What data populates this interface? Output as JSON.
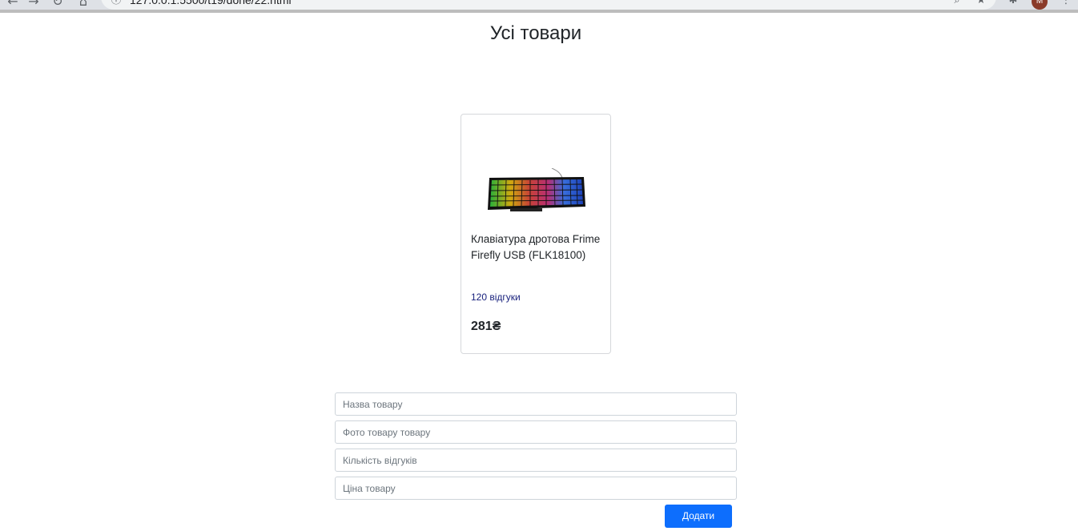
{
  "browser": {
    "url": "127.0.0.1:5500/t19/done/22.html",
    "icons": [
      "back-arrow-icon",
      "forward-arrow-icon",
      "reload-icon",
      "home-icon",
      "info-icon",
      "zoom-icon",
      "star-icon",
      "extensions-icon",
      "menu-icon"
    ],
    "profile_initial": "М"
  },
  "page": {
    "title": "Усі товари"
  },
  "product": {
    "name": "Клавіатура дротова Frime Firefly USB (FLK18100)",
    "reviews": "120 відгуки",
    "price": "281₴"
  },
  "form": {
    "name_placeholder": "Назва товару",
    "photo_placeholder": "Фото товару товару",
    "reviews_placeholder": "Кількість відгуків",
    "price_placeholder": "Ціна товару",
    "submit_label": "Додати"
  },
  "colors": {
    "accent": "#0d6efd",
    "reviews_text": "#1a237e"
  }
}
